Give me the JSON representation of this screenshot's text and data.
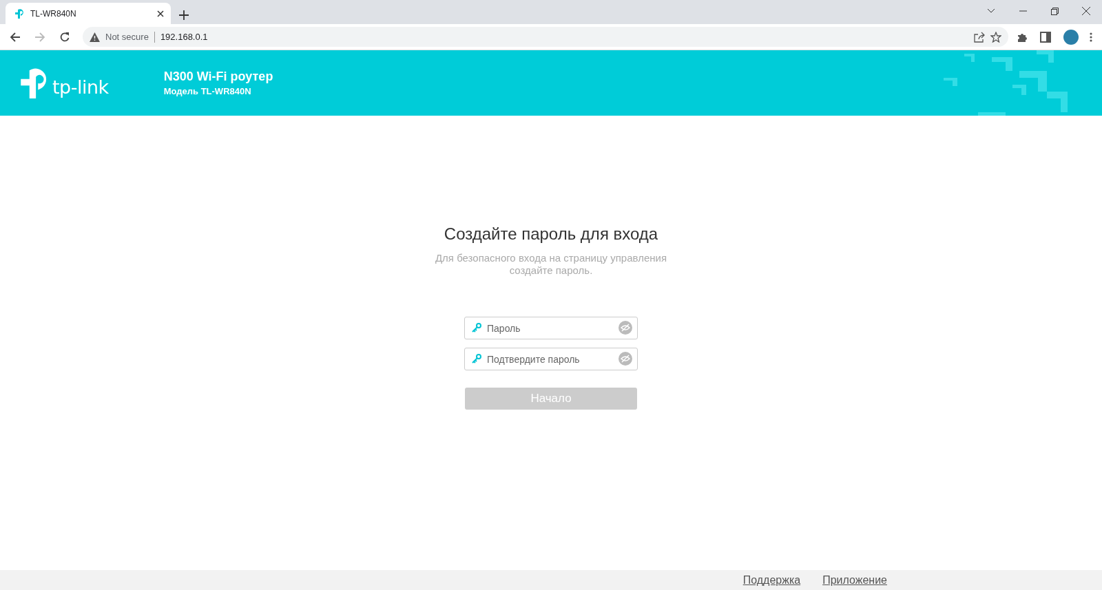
{
  "browser": {
    "tab_title": "TL-WR840N",
    "security_label": "Not secure",
    "url": "192.168.0.1"
  },
  "header": {
    "logo_text": "tp-link",
    "product": "N300 Wi-Fi роутер",
    "model": "Модель TL-WR840N"
  },
  "form": {
    "title": "Создайте пароль для входа",
    "subtitle": "Для безопасного входа на страницу управления создайте пароль.",
    "fields": [
      {
        "placeholder": "Пароль"
      },
      {
        "placeholder": "Подтвердите пароль"
      }
    ],
    "submit": {
      "label": "Начало",
      "disabled": true
    }
  },
  "footer": {
    "links": [
      "Поддержка",
      "Приложение"
    ]
  }
}
